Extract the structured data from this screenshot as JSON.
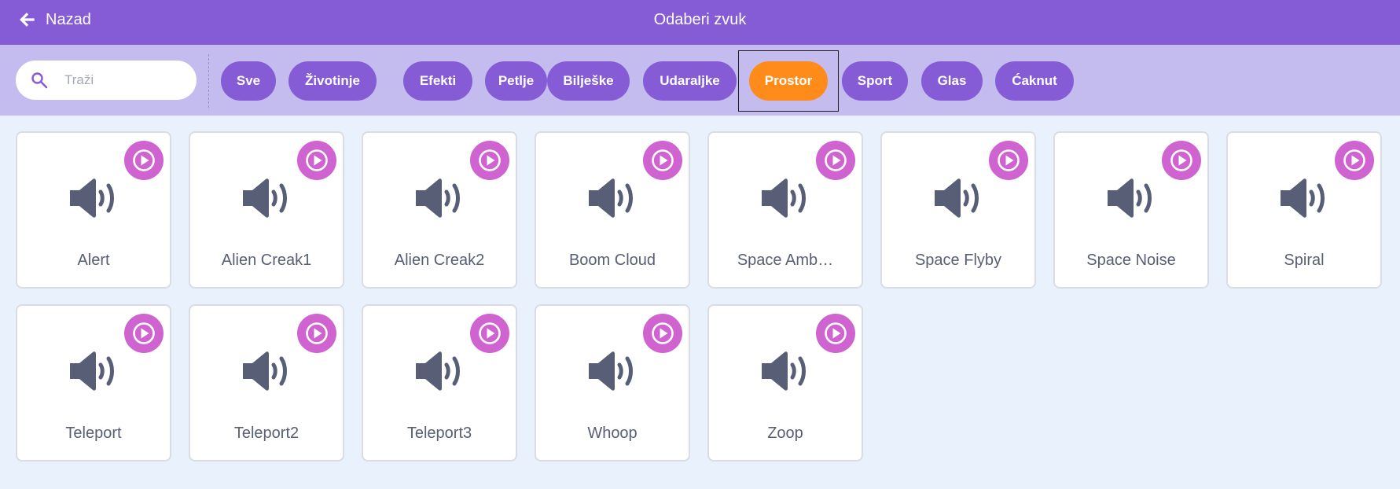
{
  "header": {
    "back_label": "Nazad",
    "title": "Odaberi zvuk"
  },
  "search": {
    "placeholder": "Traži"
  },
  "tags": [
    "Sve",
    "Životinje",
    "Efekti",
    "Petlje",
    "Bilješke",
    "Udaraljke",
    "Prostor",
    "Sport",
    "Glas",
    "Ćaknut"
  ],
  "active_tag": "Prostor",
  "sounds": [
    "Alert",
    "Alien Creak1",
    "Alien Creak2",
    "Boom Cloud",
    "Space Amb…",
    "Space Flyby",
    "Space Noise",
    "Spiral",
    "Teleport",
    "Teleport2",
    "Teleport3",
    "Whoop",
    "Zoop"
  ],
  "colors": {
    "header": "#855cd6",
    "filter_bar": "#c4bbee",
    "tag": "#855cd6",
    "tag_active": "#ff8c1a",
    "play_button": "#cf63cf",
    "speaker_icon": "#575e75",
    "background": "#e9f1fc"
  },
  "icons": {
    "back": "arrow-left-icon",
    "search": "search-icon",
    "play": "play-icon",
    "sound": "speaker-icon"
  }
}
